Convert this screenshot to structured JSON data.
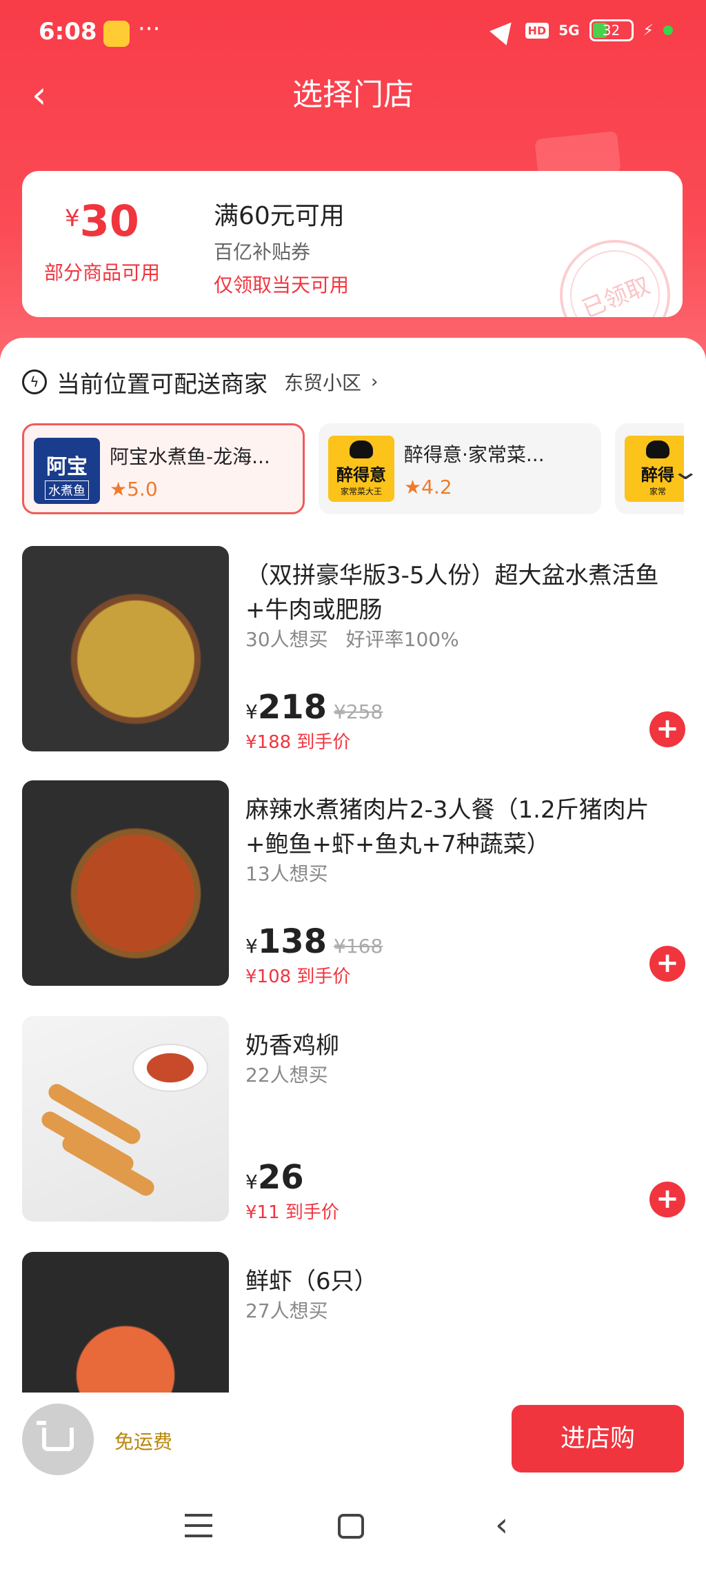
{
  "status_bar": {
    "time": "6:08",
    "dots": "···",
    "hd": "HD",
    "network": "5G",
    "battery": "32"
  },
  "header": {
    "title": "选择门店"
  },
  "coupon": {
    "currency": "¥",
    "amount": "30",
    "scope": "部分商品可用",
    "condition": "满60元可用",
    "kind": "百亿补贴券",
    "limit": "仅领取当天可用",
    "stamp": "已领取"
  },
  "location": {
    "title": "当前位置可配送商家",
    "area": "东贸小区",
    "chevron": "›"
  },
  "stores": [
    {
      "name": "阿宝水煮鱼-龙海...",
      "rating": "5.0",
      "logo_big": "阿宝",
      "logo_small": "水煮鱼"
    },
    {
      "name": "醉得意·家常菜...",
      "rating": "4.2",
      "logo_big": "醉得意",
      "logo_small": "家常菜大王"
    },
    {
      "name": "",
      "rating": "",
      "logo_big": "醉得",
      "logo_small": "家常"
    }
  ],
  "products": [
    {
      "name": "（双拼豪华版3-5人份）超大盆水煮活鱼+牛肉或肥肠",
      "wants": "30人想买",
      "praise": "好评率100%",
      "price": "218",
      "orig": "¥258",
      "hand_price": "¥188 到手价"
    },
    {
      "name": "麻辣水煮猪肉片2-3人餐（1.2斤猪肉片+鲍鱼+虾+鱼丸+7种蔬菜）",
      "wants": "13人想买",
      "praise": "",
      "price": "138",
      "orig": "¥168",
      "hand_price": "¥108 到手价"
    },
    {
      "name": "奶香鸡柳",
      "wants": "22人想买",
      "praise": "",
      "price": "26",
      "orig": "",
      "hand_price": "¥11 到手价"
    },
    {
      "name": "鲜虾（6只）",
      "wants": "27人想买",
      "praise": "",
      "price": "",
      "orig": "",
      "hand_price": ""
    }
  ],
  "bottom": {
    "free_shipping": "免运费",
    "enter_store": "进店购"
  },
  "icons": {
    "star": "★",
    "add": "+",
    "back": "‹",
    "expand": "⌄"
  }
}
